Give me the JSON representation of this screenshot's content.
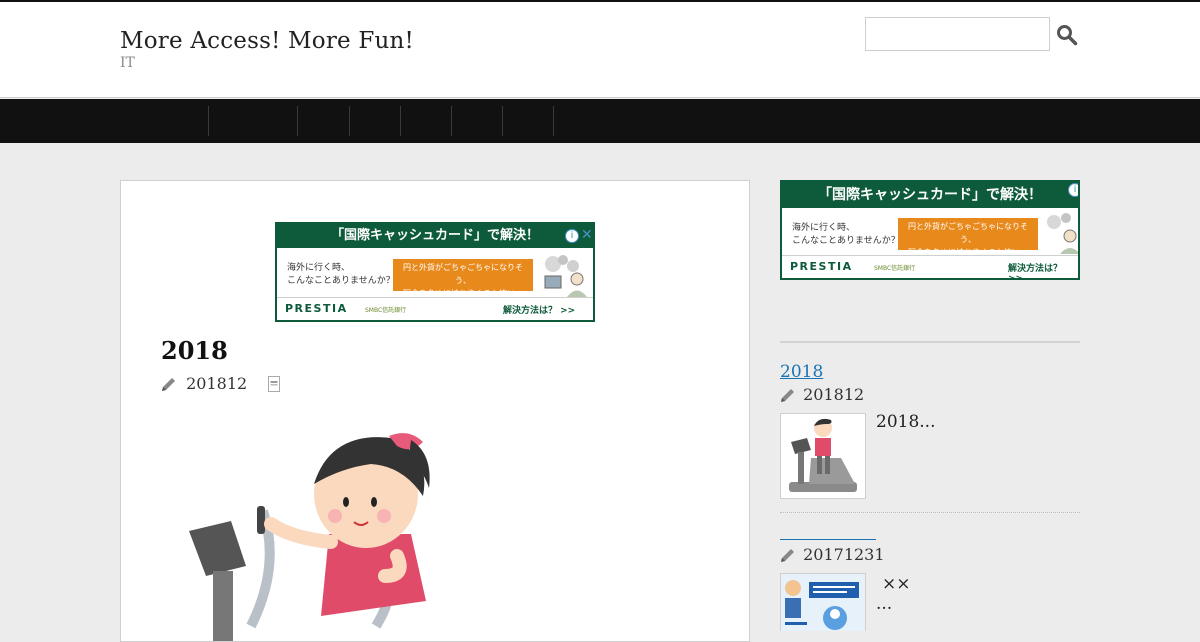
{
  "header": {
    "site_title": "More Access! More Fun!",
    "site_description": "IT",
    "search_placeholder": ""
  },
  "nav": {
    "items": [
      "",
      "",
      "",
      "",
      "",
      "",
      ""
    ]
  },
  "ad": {
    "headline": "「国際キャッシュカード」で解決！",
    "left_text_1": "海外に行く時、",
    "left_text_2": "こんなことありませんか？",
    "orange_text_1": "円と外貨がごちゃごちゃになりそう、",
    "orange_text_2": "現金を多めに持ち歩くのも怖い…",
    "brand": "PRESTIA",
    "bank": "SMBC信託銀行",
    "cta": "解決方法は？ >>",
    "info": "i",
    "close": "✕"
  },
  "post": {
    "title": "2018",
    "date": "201812"
  },
  "sidebar": {
    "items": [
      {
        "title": "2018",
        "date": "201812",
        "excerpt": "2018..."
      },
      {
        "title": "",
        "date": "20171231",
        "excerpt_line1": "××",
        "excerpt_line2": "..."
      }
    ]
  },
  "colors": {
    "nav_background": "#111111",
    "ad_green": "#0d5b3a",
    "ad_orange": "#e8891c",
    "link_blue": "#1a73b4"
  },
  "icons": [
    "search-icon",
    "pencil-icon",
    "document-icon",
    "ad-info-icon",
    "ad-close-icon"
  ]
}
